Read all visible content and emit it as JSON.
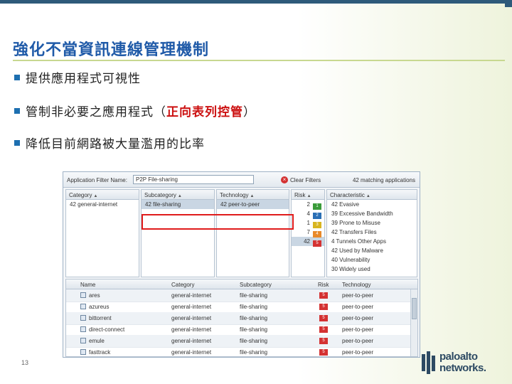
{
  "slide": {
    "title": "強化不當資訊連線管理機制",
    "bullets": [
      {
        "text": "提供應用程式可視性",
        "highlight": ""
      },
      {
        "text": "管制非必要之應用程式（",
        "highlight": "正向表列控管",
        "suffix": "）"
      },
      {
        "text": "降低目前網路被大量濫用的比率",
        "highlight": ""
      }
    ],
    "page_number": "13"
  },
  "filter": {
    "label": "Application Filter Name:",
    "value": "P2P File-sharing",
    "clear_label": "Clear Filters",
    "match_label": "42 matching applications"
  },
  "columns": {
    "category": {
      "header": "Category",
      "rows": [
        "42 general-internet"
      ]
    },
    "subcategory": {
      "header": "Subcategory",
      "rows": [
        "42 file-sharing"
      ]
    },
    "technology": {
      "header": "Technology",
      "rows": [
        "42 peer-to-peer"
      ]
    },
    "risk": {
      "header": "Risk",
      "rows": [
        {
          "count": "2",
          "level": "1",
          "color": "#3a9c3a"
        },
        {
          "count": "4",
          "level": "2",
          "color": "#2a6fb5"
        },
        {
          "count": "1",
          "level": "3",
          "color": "#d8b520"
        },
        {
          "count": "7",
          "level": "4",
          "color": "#e8892a"
        },
        {
          "count": "42",
          "level": "5",
          "color": "#d43232"
        }
      ]
    },
    "characteristic": {
      "header": "Characteristic",
      "rows": [
        "42 Evasive",
        "39 Excessive Bandwidth",
        "39 Prone to Misuse",
        "42 Transfers Files",
        "4 Tunnels Other Apps",
        "42 Used by Malware",
        "40 Vulnerability",
        "30 Widely used"
      ]
    }
  },
  "table": {
    "headers": {
      "name": "Name",
      "category": "Category",
      "subcategory": "Subcategory",
      "risk": "Risk",
      "technology": "Technology"
    },
    "rows": [
      {
        "name": "ares",
        "category": "general-internet",
        "subcategory": "file-sharing",
        "risk": "5",
        "technology": "peer-to-peer"
      },
      {
        "name": "azureus",
        "category": "general-internet",
        "subcategory": "file-sharing",
        "risk": "5",
        "technology": "peer-to-peer"
      },
      {
        "name": "bittorrent",
        "category": "general-internet",
        "subcategory": "file-sharing",
        "risk": "5",
        "technology": "peer-to-peer"
      },
      {
        "name": "direct-connect",
        "category": "general-internet",
        "subcategory": "file-sharing",
        "risk": "5",
        "technology": "peer-to-peer"
      },
      {
        "name": "emule",
        "category": "general-internet",
        "subcategory": "file-sharing",
        "risk": "5",
        "technology": "peer-to-peer"
      },
      {
        "name": "fasttrack",
        "category": "general-internet",
        "subcategory": "file-sharing",
        "risk": "5",
        "technology": "peer-to-peer"
      }
    ]
  },
  "logo": {
    "line1": "paloalto",
    "line2": "networks."
  },
  "colors": {
    "title": "#1f5aa8",
    "highlight": "#cc1111",
    "frame": "#e01b1b",
    "accent_bar": "#2e5a7a"
  }
}
